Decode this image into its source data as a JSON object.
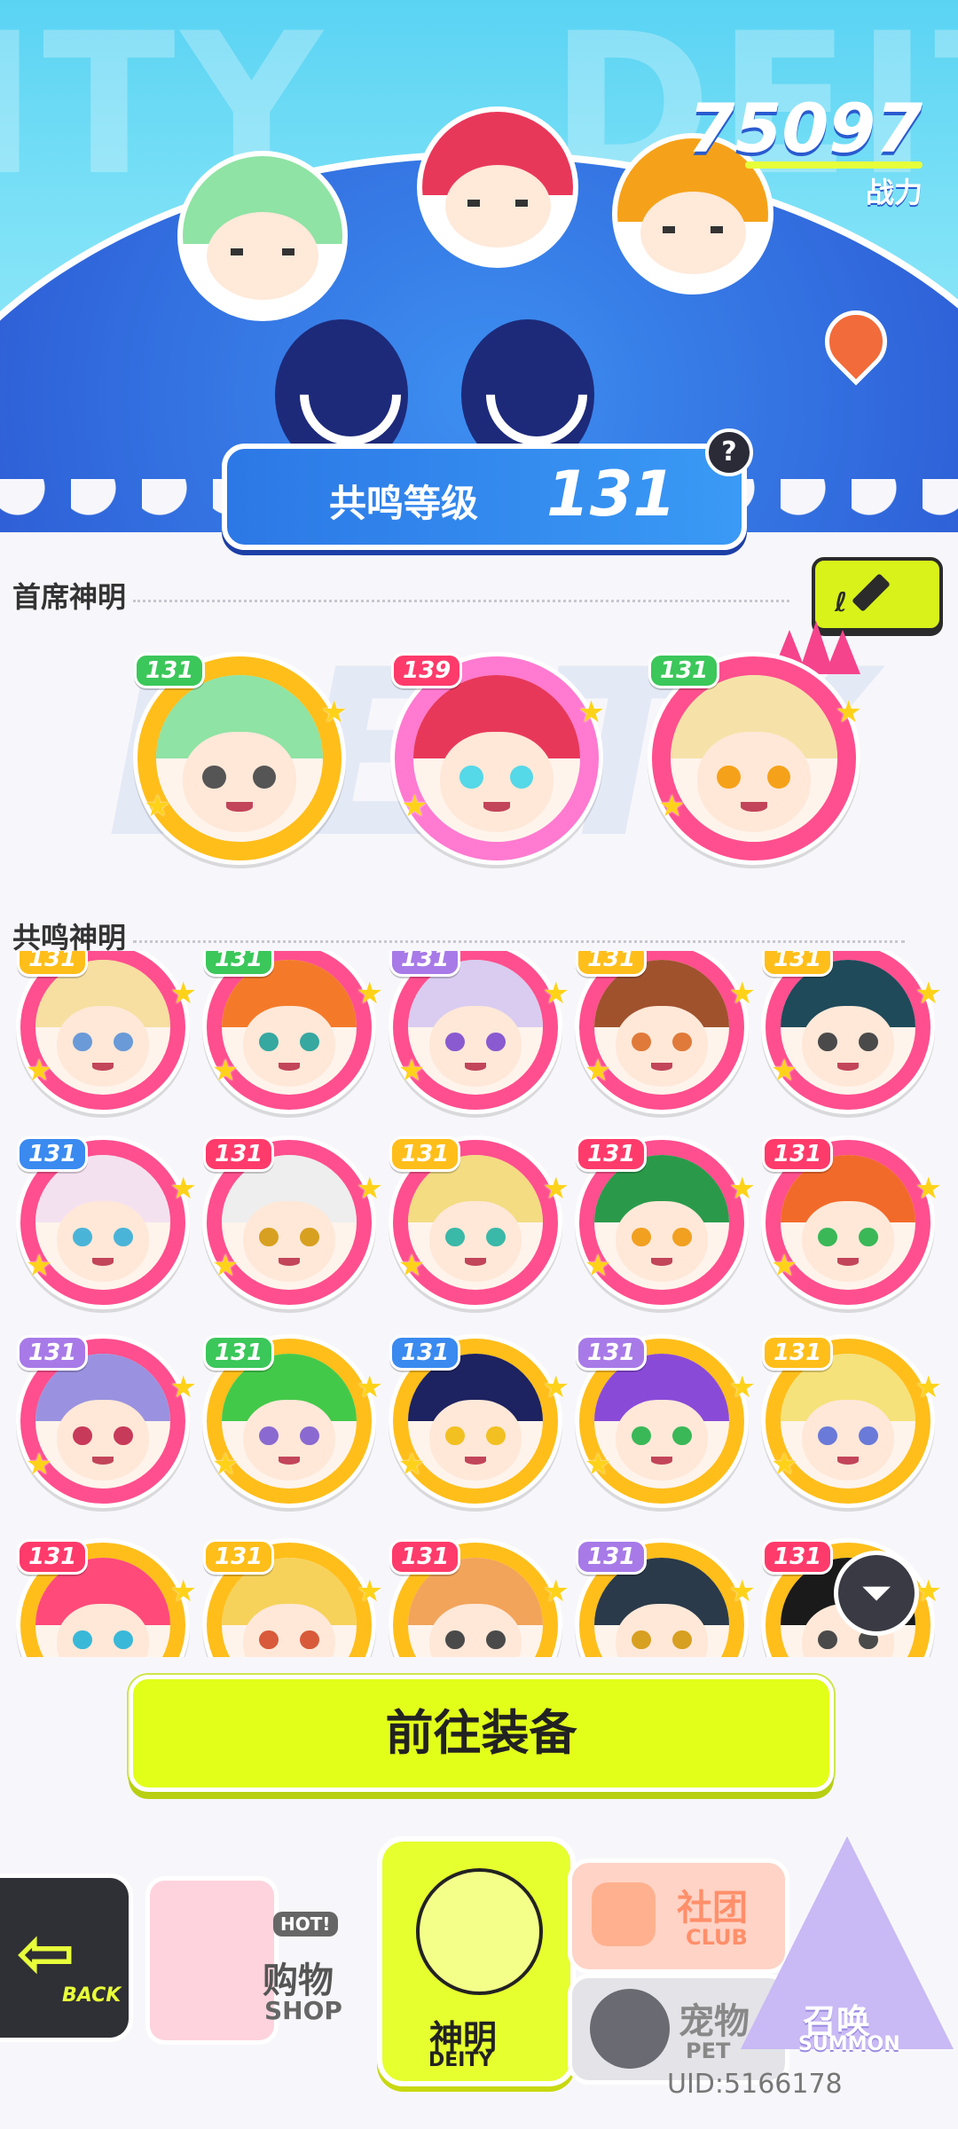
{
  "top": {
    "combat_power": "75097",
    "combat_power_label": "战力",
    "resonance_label": "共鸣等级",
    "resonance_level": "131",
    "help_icon": "question-icon"
  },
  "sections": {
    "chief_title": "首席神明",
    "resonance_title": "共鸣神明",
    "edit_icon": "pencil-icon"
  },
  "chief_deities": [
    {
      "level": "131",
      "hair": "#8fe3a4",
      "ring": "#ffbe1a",
      "tag": "#3bc75a",
      "eye": "#555555"
    },
    {
      "level": "139",
      "hair": "#e8385a",
      "ring": "#ff7ad0",
      "tag": "#ff3b6b",
      "eye": "#55d8e8"
    },
    {
      "level": "131",
      "hair": "#f6e2a8",
      "ring": "#ff4f8e",
      "tag": "#3bc75a",
      "eye": "#f5a21a"
    }
  ],
  "resonance_deities": [
    {
      "level": "131",
      "hair": "#f6dfa0",
      "ring": "#ff4f8e",
      "tag": "#ffbe1a",
      "eye": "#6a9ad8"
    },
    {
      "level": "131",
      "hair": "#f47a2a",
      "ring": "#ff4f8e",
      "tag": "#3bc75a",
      "eye": "#36a8a0"
    },
    {
      "level": "131",
      "hair": "#d9ccf0",
      "ring": "#ff4f8e",
      "tag": "#a77ae8",
      "eye": "#8a5ad0"
    },
    {
      "level": "131",
      "hair": "#a0522d",
      "ring": "#ff4f8e",
      "tag": "#ffbe1a",
      "eye": "#e07a3a"
    },
    {
      "level": "131",
      "hair": "#1f4a5a",
      "ring": "#ff4f8e",
      "tag": "#ffbe1a",
      "eye": "#4a4a4a"
    },
    {
      "level": "131",
      "hair": "#f4e1f0",
      "ring": "#ff4f8e",
      "tag": "#3a8af0",
      "eye": "#4ab4d8"
    },
    {
      "level": "131",
      "hair": "#eeeeee",
      "ring": "#ff4f8e",
      "tag": "#ff3b6b",
      "eye": "#d8a020"
    },
    {
      "level": "131",
      "hair": "#f3dc82",
      "ring": "#ff4f8e",
      "tag": "#ffbe1a",
      "eye": "#3ab8a8"
    },
    {
      "level": "131",
      "hair": "#2a9a4a",
      "ring": "#ff4f8e",
      "tag": "#ff3b6b",
      "eye": "#f2a020"
    },
    {
      "level": "131",
      "hair": "#f26a2a",
      "ring": "#ff4f8e",
      "tag": "#ff3b6b",
      "eye": "#3ab858"
    },
    {
      "level": "131",
      "hair": "#9a92e0",
      "ring": "#ff4f8e",
      "tag": "#a77ae8",
      "eye": "#c83a5a"
    },
    {
      "level": "131",
      "hair": "#43c94a",
      "ring": "#ffbe1a",
      "tag": "#3bc75a",
      "eye": "#8a6ad0"
    },
    {
      "level": "131",
      "hair": "#1d2260",
      "ring": "#ffbe1a",
      "tag": "#3a8af0",
      "eye": "#f2c020"
    },
    {
      "level": "131",
      "hair": "#8a4ad8",
      "ring": "#ffbe1a",
      "tag": "#a77ae8",
      "eye": "#3ab858"
    },
    {
      "level": "131",
      "hair": "#f6e27a",
      "ring": "#ffbe1a",
      "tag": "#ffbe1a",
      "eye": "#6a7ad8"
    },
    {
      "level": "131",
      "hair": "#ff4a7a",
      "ring": "#ffbe1a",
      "tag": "#ff3b6b",
      "eye": "#3ab8d8"
    },
    {
      "level": "131",
      "hair": "#f6d25a",
      "ring": "#ffbe1a",
      "tag": "#ffbe1a",
      "eye": "#d85a3a"
    },
    {
      "level": "131",
      "hair": "#f2a45a",
      "ring": "#ffbe1a",
      "tag": "#ff3b6b",
      "eye": "#4a4a4a"
    },
    {
      "level": "131",
      "hair": "#2a3a4a",
      "ring": "#ffbe1a",
      "tag": "#a77ae8",
      "eye": "#d8a020"
    },
    {
      "level": "131",
      "hair": "#1a1a1a",
      "ring": "#ffbe1a",
      "tag": "#ff3b6b",
      "eye": "#4a4a4a"
    }
  ],
  "filter_icon": "filter-icon",
  "equip_button": "前往装备",
  "nav": {
    "back_label": "BACK",
    "shop_cn": "购物",
    "shop_en": "SHOP",
    "shop_hot": "HOT!",
    "deity_cn": "神明",
    "deity_en": "DEITY",
    "club_cn": "社团",
    "club_en": "CLUB",
    "pet_cn": "宠物",
    "pet_en": "PET",
    "summon_cn": "召唤",
    "summon_en": "SUMMON"
  },
  "uid": "UID:5166178",
  "colors": {
    "accent": "#e2ff1a",
    "banner_sky": "#5ad3f3",
    "planet": "#2f63d9",
    "rare_ring": "#ff4f8e",
    "gold_ring": "#ffbe1a"
  }
}
